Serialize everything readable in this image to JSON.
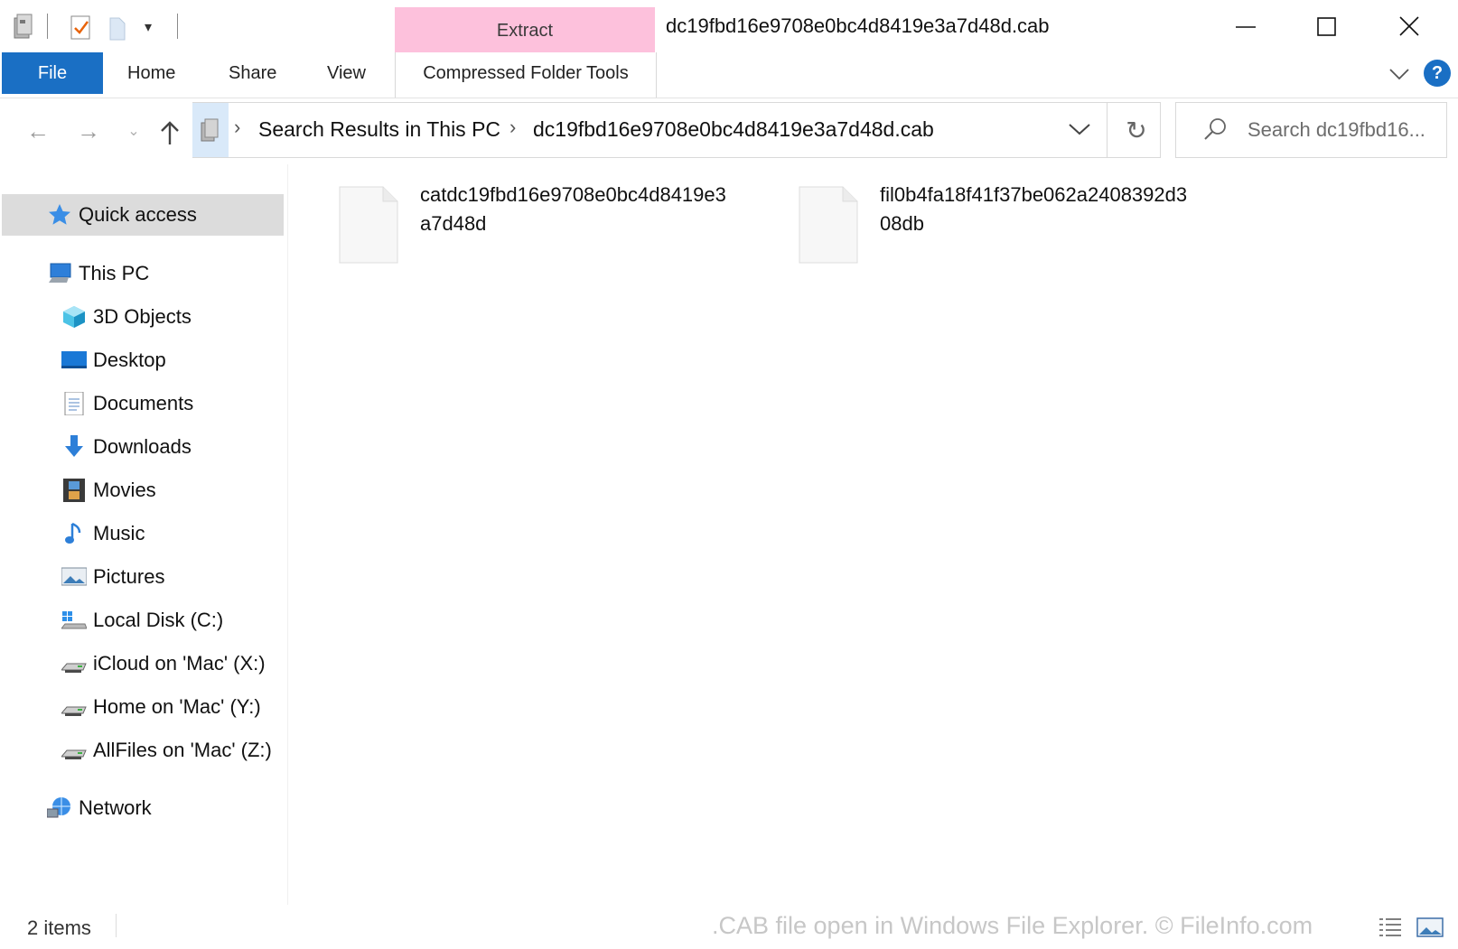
{
  "window": {
    "title": "dc19fbd16e9708e0bc4d8419e3a7d48d.cab",
    "context_group": "Extract",
    "context_tab": "Compressed Folder Tools"
  },
  "ribbon": {
    "file": "File",
    "tabs": [
      "Home",
      "Share",
      "View"
    ]
  },
  "address": {
    "crumbs": [
      "Search Results in This PC",
      "dc19fbd16e9708e0bc4d8419e3a7d48d.cab"
    ],
    "search_placeholder": "Search dc19fbd16..."
  },
  "sidebar": {
    "quick_access": "Quick access",
    "this_pc": "This PC",
    "items": [
      "3D Objects",
      "Desktop",
      "Documents",
      "Downloads",
      "Movies",
      "Music",
      "Pictures",
      "Local Disk (C:)",
      "iCloud on 'Mac' (X:)",
      "Home on 'Mac' (Y:)",
      "AllFiles on 'Mac' (Z:)"
    ],
    "network": "Network"
  },
  "files": [
    {
      "line1": "catdc19fbd16e9708e0bc4d8419e3",
      "line2": "a7d48d"
    },
    {
      "line1": "fil0b4fa18f41f37be062a2408392d3",
      "line2": "08db"
    }
  ],
  "status": {
    "count": "2 items",
    "watermark": ".CAB file open in Windows File Explorer. © FileInfo.com"
  },
  "colors": {
    "accent": "#1a6fc4",
    "context_tab": "#fdc1dc",
    "selected_nav": "#dcdcdc"
  }
}
